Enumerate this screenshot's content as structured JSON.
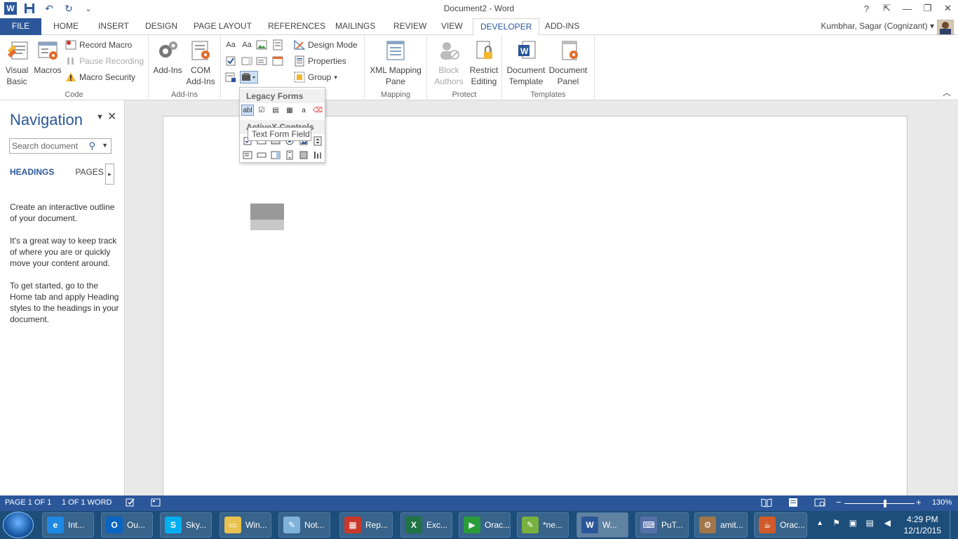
{
  "window": {
    "title": "Document2 - Word"
  },
  "qat": {
    "undo": "↶",
    "redo": "↻",
    "more": "⌄"
  },
  "window_controls": {
    "help": "?",
    "restore_ribbon": "⇱",
    "minimize": "—",
    "maximize": "❐",
    "close": "✕"
  },
  "tabs": [
    "FILE",
    "HOME",
    "INSERT",
    "DESIGN",
    "PAGE LAYOUT",
    "REFERENCES",
    "MAILINGS",
    "REVIEW",
    "VIEW",
    "DEVELOPER",
    "ADD-INS"
  ],
  "active_tab": "DEVELOPER",
  "user": {
    "name": "Kumbhar, Sagar (Cognizant)"
  },
  "ribbon": {
    "code": {
      "label": "Code",
      "visual_basic": "Visual Basic",
      "macros": "Macros",
      "record_macro": "Record Macro",
      "pause_recording": "Pause Recording",
      "macro_security": "Macro Security"
    },
    "addins": {
      "label": "Add-Ins",
      "addins": "Add-Ins",
      "com_addins": "COM Add-Ins"
    },
    "controls": {
      "design_mode": "Design Mode",
      "properties": "Properties",
      "group": "Group",
      "aa1": "Aa",
      "aa2": "Aa"
    },
    "mapping": {
      "label": "Mapping",
      "xml_pane": "XML Mapping Pane"
    },
    "protect": {
      "label": "Protect",
      "block_authors": "Block Authors",
      "restrict_editing": "Restrict Editing"
    },
    "templates": {
      "label": "Templates",
      "document_template": "Document Template",
      "document_panel": "Document Panel"
    }
  },
  "dropdown": {
    "legacy_header": "Legacy Forms",
    "activex_header": "ActiveX Controls",
    "tooltip": "Text Form Field",
    "legacy_items": [
      "abl",
      "☑",
      "▤",
      "▦",
      "a",
      "⌫"
    ]
  },
  "nav": {
    "title": "Navigation",
    "search_placeholder": "Search document",
    "tab_headings": "HEADINGS",
    "tab_pages": "PAGES",
    "text1": "Create an interactive outline of your document.",
    "text2": "It's a great way to keep track of where you are or quickly move your content around.",
    "text3": "To get started, go to the Home tab and apply Heading styles to the headings in your document."
  },
  "status": {
    "page": "PAGE 1 OF 1",
    "words": "1 OF 1 WORD",
    "zoom": "130%",
    "zoom_level": 0.58
  },
  "taskbar": {
    "items": [
      {
        "label": "Int...",
        "color": "#1e88e5",
        "glyph": "e"
      },
      {
        "label": "Ou...",
        "color": "#0a64c2",
        "glyph": "O"
      },
      {
        "label": "Sky...",
        "color": "#00aff0",
        "glyph": "S"
      },
      {
        "label": "Win...",
        "color": "#e8c150",
        "glyph": "▭"
      },
      {
        "label": "Not...",
        "color": "#7fb2d8",
        "glyph": "✎"
      },
      {
        "label": "Rep...",
        "color": "#c8392b",
        "glyph": "▦"
      },
      {
        "label": "Exc...",
        "color": "#217346",
        "glyph": "X"
      },
      {
        "label": "Orac...",
        "color": "#2a9d3a",
        "glyph": "▶"
      },
      {
        "label": "*ne...",
        "color": "#78b13f",
        "glyph": "✎"
      },
      {
        "label": "W...",
        "color": "#2b579a",
        "glyph": "W"
      },
      {
        "label": "PuT...",
        "color": "#5570a8",
        "glyph": "⌨"
      },
      {
        "label": "amit...",
        "color": "#a0764a",
        "glyph": "⚙"
      },
      {
        "label": "Orac...",
        "color": "#d05a2a",
        "glyph": "☕"
      }
    ],
    "time": "4:29 PM",
    "date": "12/1/2015"
  }
}
